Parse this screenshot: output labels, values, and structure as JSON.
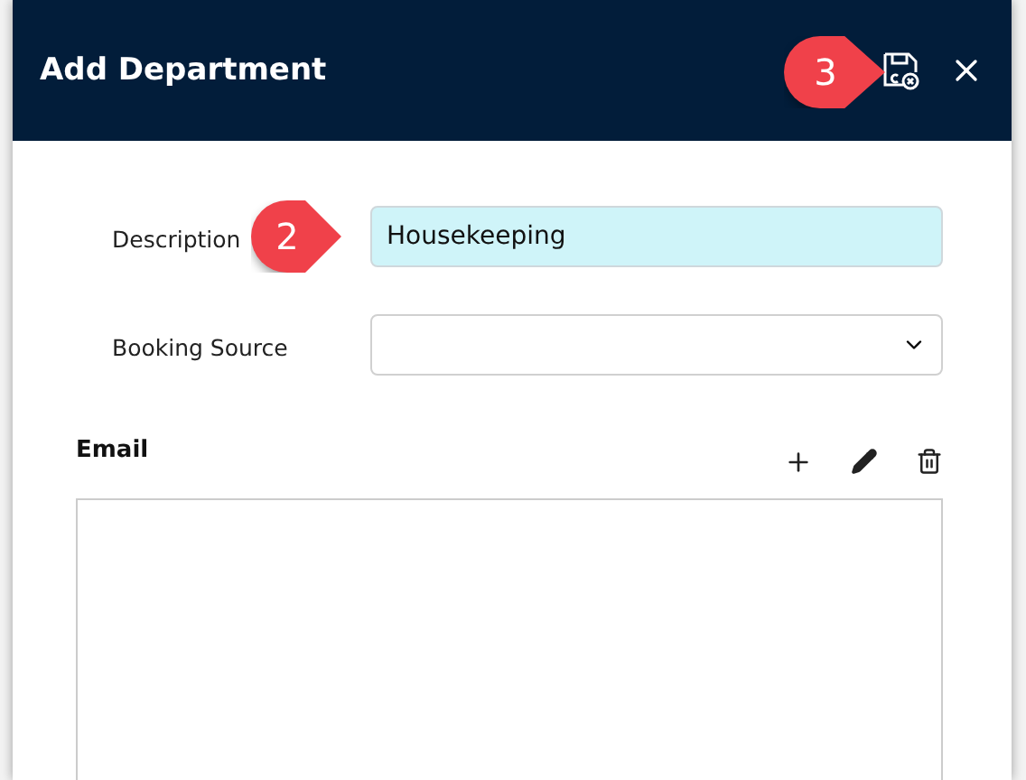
{
  "dialog": {
    "title": "Add Department"
  },
  "callouts": [
    {
      "number": "2"
    },
    {
      "number": "3"
    }
  ],
  "fields": [
    {
      "kind": "text",
      "label": "Description",
      "value": "Housekeeping"
    },
    {
      "kind": "select",
      "label": "Booking Source"
    }
  ],
  "email": {
    "title": "Email"
  }
}
